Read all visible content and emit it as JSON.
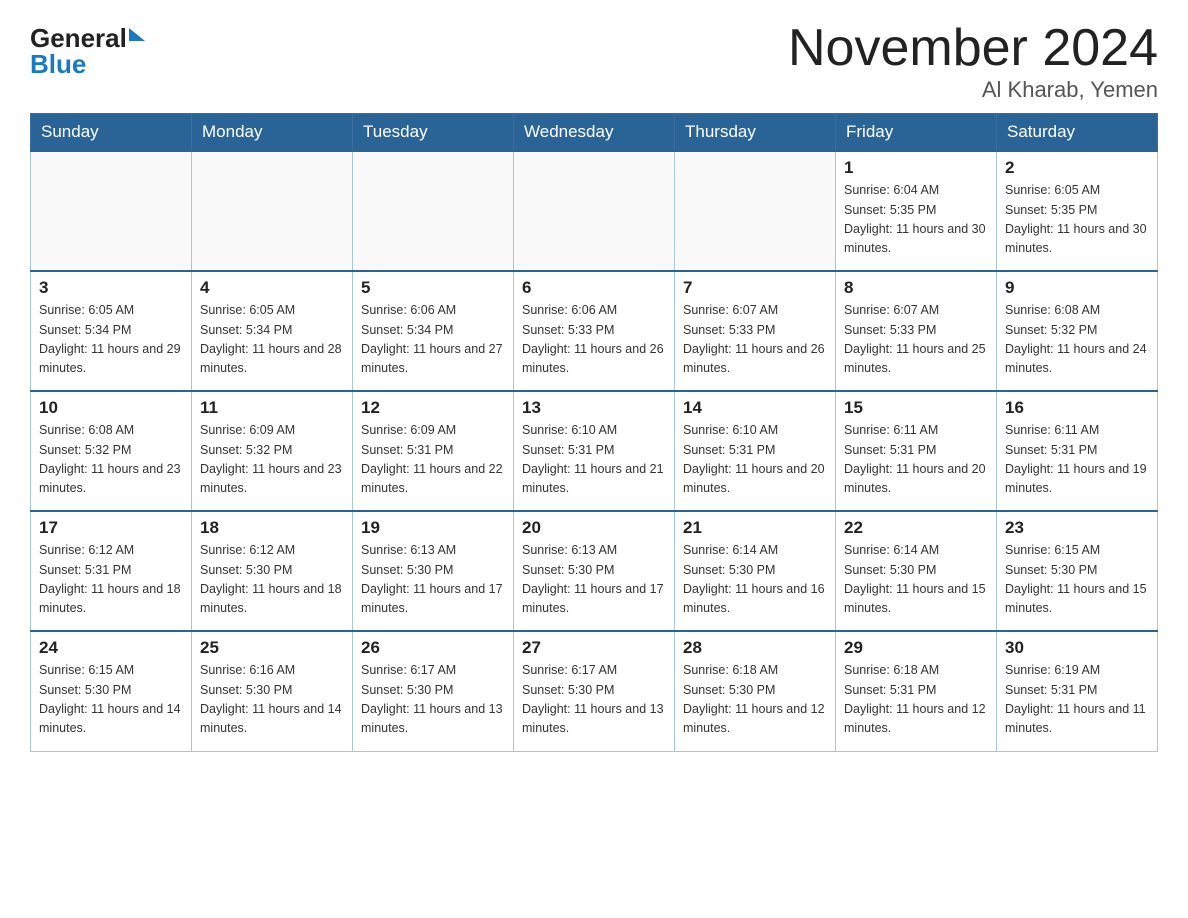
{
  "header": {
    "title": "November 2024",
    "subtitle": "Al Kharab, Yemen",
    "logo_general": "General",
    "logo_blue": "Blue"
  },
  "weekdays": [
    "Sunday",
    "Monday",
    "Tuesday",
    "Wednesday",
    "Thursday",
    "Friday",
    "Saturday"
  ],
  "weeks": [
    [
      {
        "num": "",
        "info": ""
      },
      {
        "num": "",
        "info": ""
      },
      {
        "num": "",
        "info": ""
      },
      {
        "num": "",
        "info": ""
      },
      {
        "num": "",
        "info": ""
      },
      {
        "num": "1",
        "info": "Sunrise: 6:04 AM\nSunset: 5:35 PM\nDaylight: 11 hours and 30 minutes."
      },
      {
        "num": "2",
        "info": "Sunrise: 6:05 AM\nSunset: 5:35 PM\nDaylight: 11 hours and 30 minutes."
      }
    ],
    [
      {
        "num": "3",
        "info": "Sunrise: 6:05 AM\nSunset: 5:34 PM\nDaylight: 11 hours and 29 minutes."
      },
      {
        "num": "4",
        "info": "Sunrise: 6:05 AM\nSunset: 5:34 PM\nDaylight: 11 hours and 28 minutes."
      },
      {
        "num": "5",
        "info": "Sunrise: 6:06 AM\nSunset: 5:34 PM\nDaylight: 11 hours and 27 minutes."
      },
      {
        "num": "6",
        "info": "Sunrise: 6:06 AM\nSunset: 5:33 PM\nDaylight: 11 hours and 26 minutes."
      },
      {
        "num": "7",
        "info": "Sunrise: 6:07 AM\nSunset: 5:33 PM\nDaylight: 11 hours and 26 minutes."
      },
      {
        "num": "8",
        "info": "Sunrise: 6:07 AM\nSunset: 5:33 PM\nDaylight: 11 hours and 25 minutes."
      },
      {
        "num": "9",
        "info": "Sunrise: 6:08 AM\nSunset: 5:32 PM\nDaylight: 11 hours and 24 minutes."
      }
    ],
    [
      {
        "num": "10",
        "info": "Sunrise: 6:08 AM\nSunset: 5:32 PM\nDaylight: 11 hours and 23 minutes."
      },
      {
        "num": "11",
        "info": "Sunrise: 6:09 AM\nSunset: 5:32 PM\nDaylight: 11 hours and 23 minutes."
      },
      {
        "num": "12",
        "info": "Sunrise: 6:09 AM\nSunset: 5:31 PM\nDaylight: 11 hours and 22 minutes."
      },
      {
        "num": "13",
        "info": "Sunrise: 6:10 AM\nSunset: 5:31 PM\nDaylight: 11 hours and 21 minutes."
      },
      {
        "num": "14",
        "info": "Sunrise: 6:10 AM\nSunset: 5:31 PM\nDaylight: 11 hours and 20 minutes."
      },
      {
        "num": "15",
        "info": "Sunrise: 6:11 AM\nSunset: 5:31 PM\nDaylight: 11 hours and 20 minutes."
      },
      {
        "num": "16",
        "info": "Sunrise: 6:11 AM\nSunset: 5:31 PM\nDaylight: 11 hours and 19 minutes."
      }
    ],
    [
      {
        "num": "17",
        "info": "Sunrise: 6:12 AM\nSunset: 5:31 PM\nDaylight: 11 hours and 18 minutes."
      },
      {
        "num": "18",
        "info": "Sunrise: 6:12 AM\nSunset: 5:30 PM\nDaylight: 11 hours and 18 minutes."
      },
      {
        "num": "19",
        "info": "Sunrise: 6:13 AM\nSunset: 5:30 PM\nDaylight: 11 hours and 17 minutes."
      },
      {
        "num": "20",
        "info": "Sunrise: 6:13 AM\nSunset: 5:30 PM\nDaylight: 11 hours and 17 minutes."
      },
      {
        "num": "21",
        "info": "Sunrise: 6:14 AM\nSunset: 5:30 PM\nDaylight: 11 hours and 16 minutes."
      },
      {
        "num": "22",
        "info": "Sunrise: 6:14 AM\nSunset: 5:30 PM\nDaylight: 11 hours and 15 minutes."
      },
      {
        "num": "23",
        "info": "Sunrise: 6:15 AM\nSunset: 5:30 PM\nDaylight: 11 hours and 15 minutes."
      }
    ],
    [
      {
        "num": "24",
        "info": "Sunrise: 6:15 AM\nSunset: 5:30 PM\nDaylight: 11 hours and 14 minutes."
      },
      {
        "num": "25",
        "info": "Sunrise: 6:16 AM\nSunset: 5:30 PM\nDaylight: 11 hours and 14 minutes."
      },
      {
        "num": "26",
        "info": "Sunrise: 6:17 AM\nSunset: 5:30 PM\nDaylight: 11 hours and 13 minutes."
      },
      {
        "num": "27",
        "info": "Sunrise: 6:17 AM\nSunset: 5:30 PM\nDaylight: 11 hours and 13 minutes."
      },
      {
        "num": "28",
        "info": "Sunrise: 6:18 AM\nSunset: 5:30 PM\nDaylight: 11 hours and 12 minutes."
      },
      {
        "num": "29",
        "info": "Sunrise: 6:18 AM\nSunset: 5:31 PM\nDaylight: 11 hours and 12 minutes."
      },
      {
        "num": "30",
        "info": "Sunrise: 6:19 AM\nSunset: 5:31 PM\nDaylight: 11 hours and 11 minutes."
      }
    ]
  ]
}
